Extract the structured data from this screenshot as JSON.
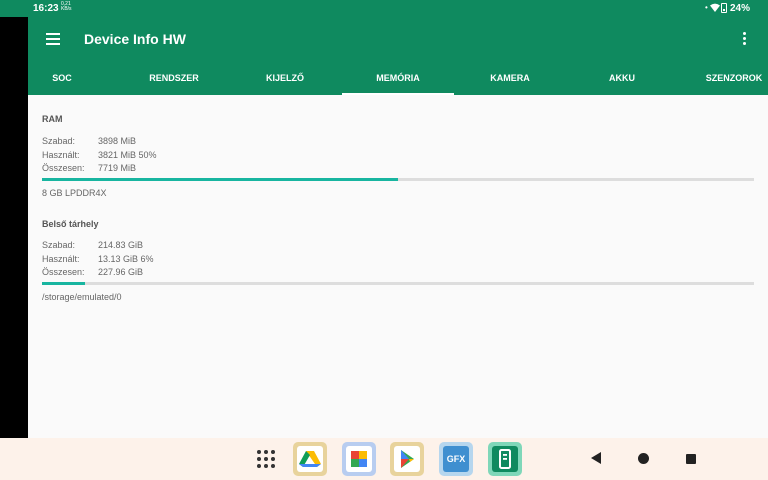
{
  "status_bar": {
    "time": "16:23",
    "net_speed_value": "0,21",
    "net_speed_unit": "KB/s",
    "dot": "•",
    "battery_percent": "24%"
  },
  "app_bar": {
    "title": "Device Info HW"
  },
  "tabs": [
    {
      "label": "SOC",
      "active": false
    },
    {
      "label": "RENDSZER",
      "active": false
    },
    {
      "label": "KIJELZŐ",
      "active": false
    },
    {
      "label": "MEMÓRIA",
      "active": true
    },
    {
      "label": "KAMERA",
      "active": false
    },
    {
      "label": "AKKU",
      "active": false
    },
    {
      "label": "SZENZOROK",
      "active": false
    }
  ],
  "ram": {
    "title": "RAM",
    "free_label": "Szabad:",
    "free_value": "3898 MiB",
    "used_label": "Használt:",
    "used_value": "3821 MiB 50%",
    "total_label": "Összesen:",
    "total_value": "7719 MiB",
    "used_fraction": 0.5,
    "type": "8 GB LPDDR4X"
  },
  "storage": {
    "title": "Belső tárhely",
    "free_label": "Szabad:",
    "free_value": "214.83 GiB",
    "used_label": "Használt:",
    "used_value": "13.13 GiB 6%",
    "total_label": "Összesen:",
    "total_value": "227.96 GiB",
    "used_fraction": 0.06,
    "path": "/storage/emulated/0"
  },
  "taskbar": {
    "apps": [
      {
        "icon": "google-drive-icon"
      },
      {
        "icon": "google-photos-icon"
      },
      {
        "icon": "play-store-icon"
      },
      {
        "icon": "gfx-bench-icon",
        "label": "GFX"
      },
      {
        "icon": "device-info-icon"
      }
    ]
  },
  "colors": {
    "primary": "#0f8a5f",
    "accent": "#18b5a0",
    "background": "#fafafa",
    "taskbar": "#fdf2ea"
  }
}
